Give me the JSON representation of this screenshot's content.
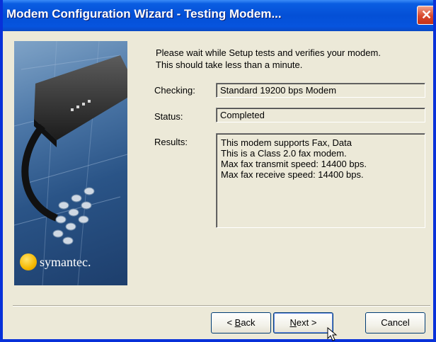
{
  "window": {
    "title": "Modem Configuration Wizard - Testing Modem...",
    "close_glyph": "✕"
  },
  "brand": {
    "name": "symantec."
  },
  "intro": {
    "line1": "Please wait while Setup tests and verifies your modem.",
    "line2": "This should take less than a minute."
  },
  "fields": {
    "checking_label": "Checking:",
    "checking_value": "Standard 19200 bps Modem",
    "status_label": "Status:",
    "status_value": "Completed",
    "results_label": "Results:",
    "results_lines": [
      "This modem supports Fax, Data",
      "This is a Class 2.0 fax modem.",
      "Max fax transmit speed:  14400 bps.",
      "Max fax receive speed:  14400 bps."
    ]
  },
  "buttons": {
    "back_prefix": "< ",
    "back_mnemonic": "B",
    "back_rest": "ack",
    "next_mnemonic": "N",
    "next_rest": "ext >",
    "cancel": "Cancel"
  },
  "icons": [
    "close-icon",
    "symantec-logo-icon",
    "modem-illustration",
    "mouse-cursor-icon"
  ]
}
